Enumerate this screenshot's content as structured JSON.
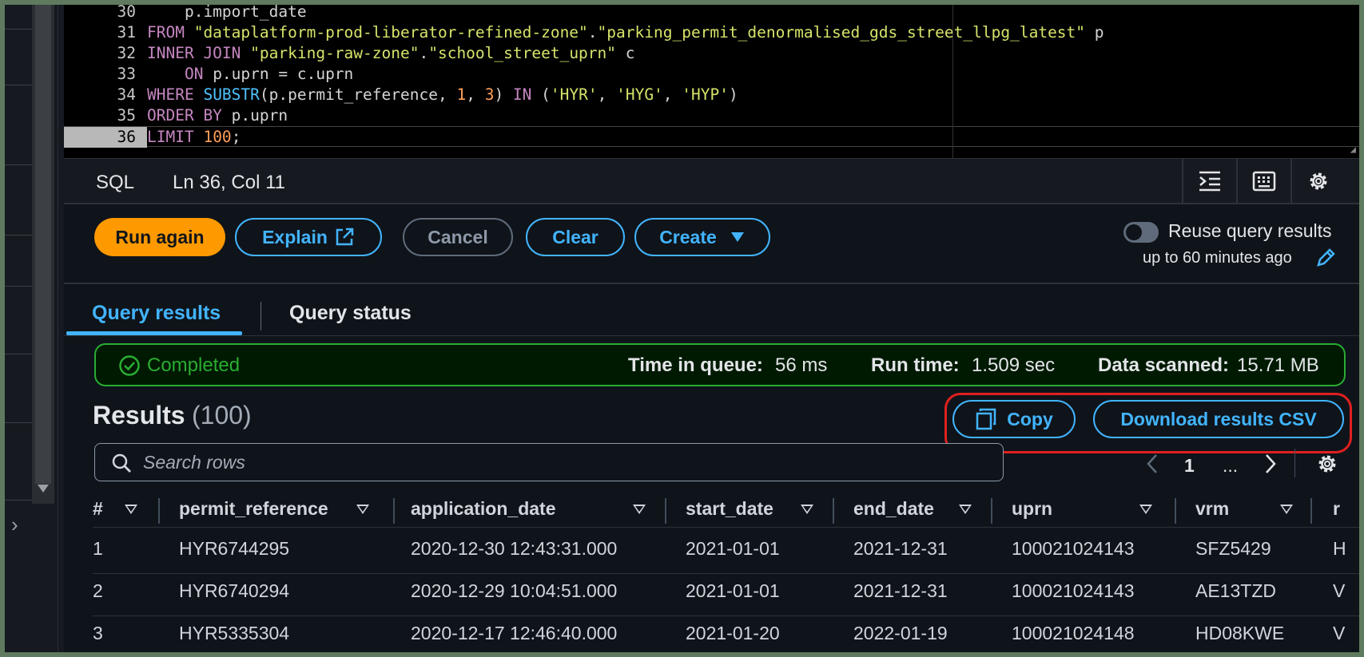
{
  "editor": {
    "lines": [
      {
        "num": "30",
        "parts": [
          {
            "t": "    p.import_date",
            "c": ""
          }
        ]
      },
      {
        "num": "31",
        "parts": [
          {
            "t": "FROM ",
            "c": "k"
          },
          {
            "t": "\"dataplatform-prod-liberator-refined-zone\"",
            "c": "s"
          },
          {
            "t": ".",
            "c": ""
          },
          {
            "t": "\"parking_permit_denormalised_gds_street_llpg_latest\"",
            "c": "s"
          },
          {
            "t": " p",
            "c": ""
          }
        ]
      },
      {
        "num": "32",
        "parts": [
          {
            "t": "INNER JOIN ",
            "c": "k"
          },
          {
            "t": "\"parking-raw-zone\"",
            "c": "s"
          },
          {
            "t": ".",
            "c": ""
          },
          {
            "t": "\"school_street_uprn\"",
            "c": "s"
          },
          {
            "t": " c",
            "c": ""
          }
        ]
      },
      {
        "num": "33",
        "parts": [
          {
            "t": "    ON ",
            "c": "k"
          },
          {
            "t": "p.uprn = c.uprn",
            "c": ""
          }
        ]
      },
      {
        "num": "34",
        "parts": [
          {
            "t": "WHERE ",
            "c": "k"
          },
          {
            "t": "SUBSTR",
            "c": "f"
          },
          {
            "t": "(p.permit_reference, ",
            "c": ""
          },
          {
            "t": "1",
            "c": "n"
          },
          {
            "t": ", ",
            "c": ""
          },
          {
            "t": "3",
            "c": "n"
          },
          {
            "t": ") ",
            "c": ""
          },
          {
            "t": "IN ",
            "c": "k"
          },
          {
            "t": "(",
            "c": ""
          },
          {
            "t": "'HYR'",
            "c": "s"
          },
          {
            "t": ", ",
            "c": ""
          },
          {
            "t": "'HYG'",
            "c": "s"
          },
          {
            "t": ", ",
            "c": ""
          },
          {
            "t": "'HYP'",
            "c": "s"
          },
          {
            "t": ")",
            "c": ""
          }
        ]
      },
      {
        "num": "35",
        "parts": [
          {
            "t": "ORDER BY ",
            "c": "k"
          },
          {
            "t": "p.uprn",
            "c": ""
          }
        ]
      },
      {
        "num": "36",
        "parts": [
          {
            "t": "LIMIT ",
            "c": "k"
          },
          {
            "t": "100",
            "c": "n"
          },
          {
            "t": ";",
            "c": ""
          }
        ]
      }
    ]
  },
  "status_bar": {
    "language": "SQL",
    "position": "Ln 36, Col 11",
    "tools": [
      "format-icon",
      "keyboard-icon",
      "settings-icon"
    ]
  },
  "actions": {
    "run_again": "Run again",
    "explain": "Explain",
    "cancel": "Cancel",
    "clear": "Clear",
    "create": "Create",
    "reuse_label": "Reuse query results",
    "reuse_window": "up to 60 minutes ago"
  },
  "tabs": {
    "results": "Query results",
    "status": "Query status"
  },
  "banner": {
    "status": "Completed",
    "queue_label": "Time in queue:",
    "queue_value": "56 ms",
    "run_label": "Run time:",
    "run_value": "1.509 sec",
    "scanned_label": "Data scanned:",
    "scanned_value": "15.71 MB"
  },
  "results": {
    "title": "Results",
    "count": "(100)",
    "copy": "Copy",
    "download": "Download results CSV"
  },
  "search": {
    "placeholder": "Search rows"
  },
  "pagination": {
    "page": "1",
    "ellipsis": "..."
  },
  "table": {
    "columns": [
      "#",
      "permit_reference",
      "application_date",
      "start_date",
      "end_date",
      "uprn",
      "vrm",
      "r"
    ],
    "rows": [
      [
        "1",
        "HYR6744295",
        "2020-12-30 12:43:31.000",
        "2021-01-01",
        "2021-12-31",
        "100021024143",
        "SFZ5429",
        "H"
      ],
      [
        "2",
        "HYR6740294",
        "2020-12-29 10:04:51.000",
        "2021-01-01",
        "2021-12-31",
        "100021024143",
        "AE13TZD",
        "V"
      ],
      [
        "3",
        "HYR5335304",
        "2020-12-17 12:46:40.000",
        "2021-01-20",
        "2022-01-19",
        "100021024148",
        "HD08KWE",
        "V"
      ]
    ]
  },
  "colors": {
    "accent": "#42b4ff",
    "primary": "#ff9900",
    "success": "#29ad32",
    "highlight": "#e02020"
  }
}
